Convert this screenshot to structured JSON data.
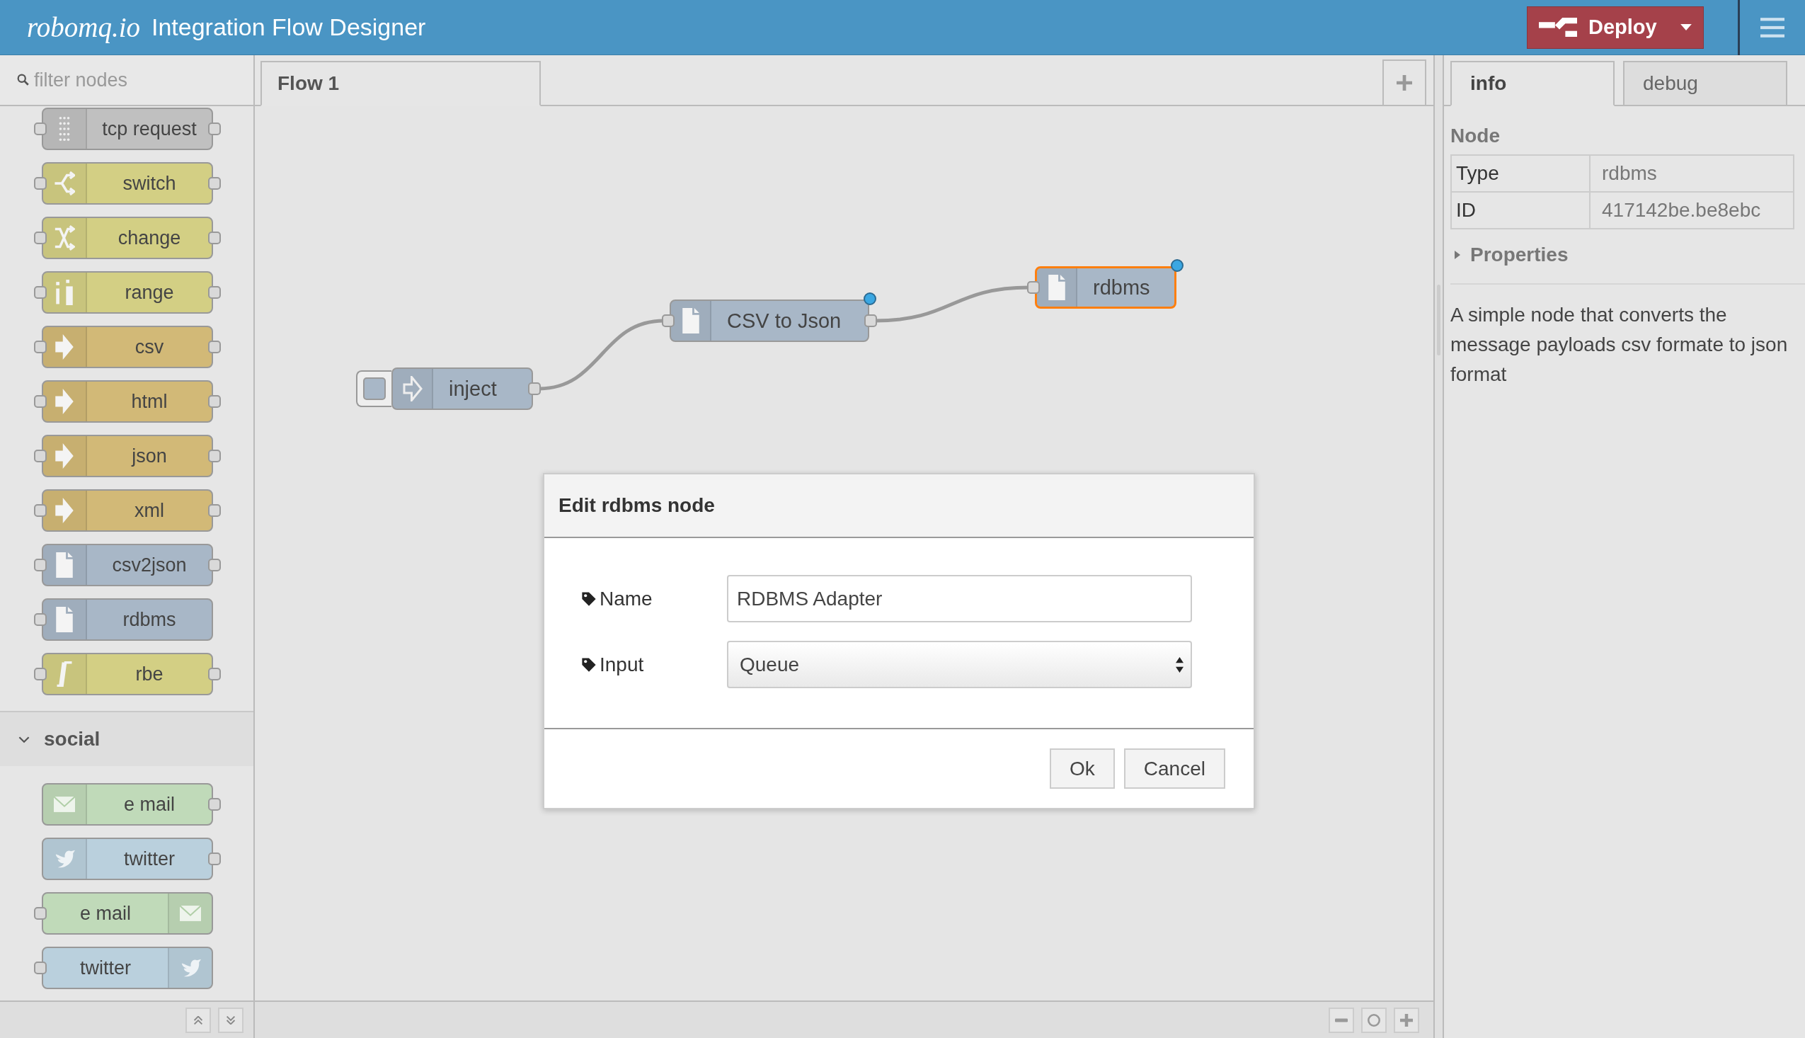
{
  "header": {
    "logo": "robomq.io",
    "title": "Integration Flow Designer",
    "deploy": {
      "label": "Deploy"
    }
  },
  "palette": {
    "filter": {
      "placeholder": "filter nodes"
    },
    "nodes": [
      {
        "label": "tcp request",
        "kind": "tcp",
        "color": "#c0c0c0",
        "icon_right": false,
        "input": true,
        "output": true
      },
      {
        "label": "switch",
        "kind": "switch",
        "color": "#d3cf84",
        "icon_right": false,
        "input": true,
        "output": true
      },
      {
        "label": "change",
        "kind": "change",
        "color": "#d3cf84",
        "icon_right": false,
        "input": true,
        "output": true
      },
      {
        "label": "range",
        "kind": "range",
        "color": "#d3cf84",
        "icon_right": false,
        "input": true,
        "output": true
      },
      {
        "label": "csv",
        "kind": "parser",
        "color": "#d2b977",
        "icon_right": false,
        "input": true,
        "output": true
      },
      {
        "label": "html",
        "kind": "parser",
        "color": "#d2b977",
        "icon_right": false,
        "input": true,
        "output": true
      },
      {
        "label": "json",
        "kind": "parser",
        "color": "#d2b977",
        "icon_right": false,
        "input": true,
        "output": true
      },
      {
        "label": "xml",
        "kind": "parser",
        "color": "#d2b977",
        "icon_right": false,
        "input": true,
        "output": true
      },
      {
        "label": "csv2json",
        "kind": "file",
        "color": "#a8b7c7",
        "icon_right": false,
        "input": true,
        "output": true
      },
      {
        "label": "rdbms",
        "kind": "file",
        "color": "#a8b7c7",
        "icon_right": false,
        "input": true,
        "output": false
      },
      {
        "label": "rbe",
        "kind": "rbe",
        "color": "#d3cf84",
        "icon_right": false,
        "input": true,
        "output": true
      }
    ],
    "categories": [
      {
        "name": "social",
        "expanded": true,
        "nodes": [
          {
            "label": "e mail",
            "kind": "mail",
            "color": "#c0dab9",
            "icon_right": false,
            "input": false,
            "output": true
          },
          {
            "label": "twitter",
            "kind": "twitter",
            "color": "#bad0dd",
            "icon_right": false,
            "input": false,
            "output": true
          },
          {
            "label": "e mail",
            "kind": "mail",
            "color": "#c0dab9",
            "icon_right": true,
            "input": true,
            "output": false
          },
          {
            "label": "twitter",
            "kind": "twitter",
            "color": "#bad0dd",
            "icon_right": true,
            "input": true,
            "output": false
          }
        ]
      }
    ]
  },
  "workspace": {
    "tabs": [
      {
        "label": "Flow 1",
        "selected": true
      }
    ],
    "nodes": [
      {
        "label": "inject",
        "kind": "inject",
        "color": "#a8b7c7",
        "input": false,
        "output": true,
        "wired": true,
        "selected": false,
        "changed": false
      },
      {
        "label": "CSV to Json",
        "kind": "file",
        "color": "#a8b7c7",
        "input": true,
        "output": true,
        "wired": true,
        "selected": false,
        "changed": true
      },
      {
        "label": "rdbms",
        "kind": "file",
        "color": "#a8b7c7",
        "input": true,
        "output": false,
        "wired": false,
        "selected": true,
        "changed": true
      }
    ]
  },
  "dialog": {
    "title": "Edit rdbms node",
    "fields": [
      {
        "label": "Name",
        "kind": "text",
        "value": "RDBMS Adapter"
      },
      {
        "label": "Input",
        "kind": "select",
        "value": "Queue"
      }
    ],
    "buttons": [
      "Ok",
      "Cancel"
    ]
  },
  "sidebar": {
    "tabs": [
      {
        "label": "info",
        "selected": true
      },
      {
        "label": "debug",
        "selected": false
      }
    ],
    "section": "Node",
    "table": [
      [
        "Type",
        "rdbms"
      ],
      [
        "ID",
        "417142be.be8ebc"
      ]
    ],
    "properties": {
      "label": "Properties",
      "expanded": false
    },
    "description": "A simple node that converts the message payloads csv formate to json format"
  }
}
